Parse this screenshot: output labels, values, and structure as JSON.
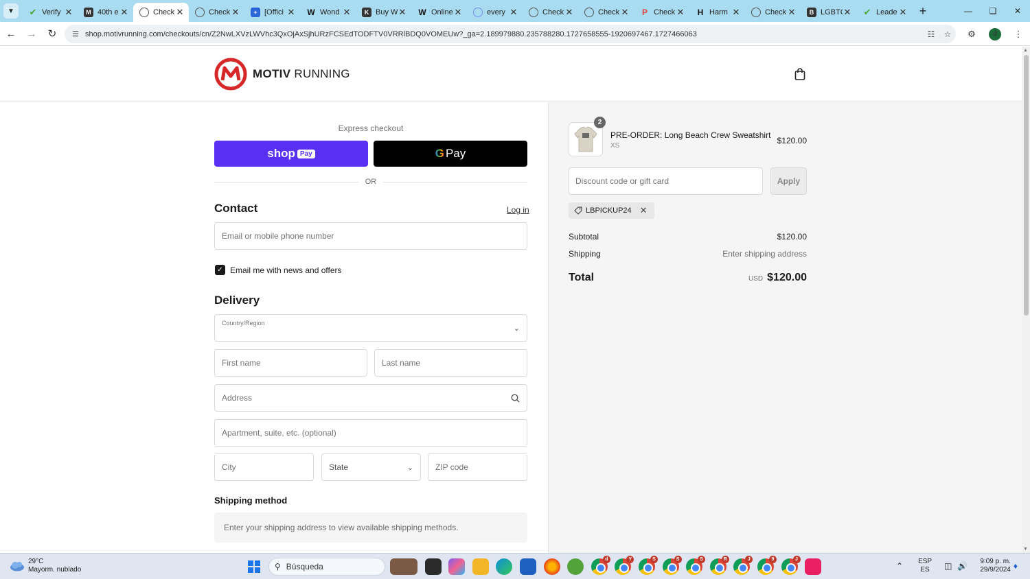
{
  "browser": {
    "tabs": [
      {
        "label": "Verify",
        "icon": "verify-check-favicon",
        "active": false
      },
      {
        "label": "40th e",
        "icon": "m-favicon",
        "active": false
      },
      {
        "label": "Check",
        "icon": "globe-favicon",
        "active": true
      },
      {
        "label": "Check",
        "icon": "globe-favicon",
        "active": false
      },
      {
        "label": "[Offici",
        "icon": "plus-favicon",
        "active": false
      },
      {
        "label": "Wond",
        "icon": "w-favicon",
        "active": false
      },
      {
        "label": "Buy W",
        "icon": "k-favicon",
        "active": false
      },
      {
        "label": "Online",
        "icon": "w-favicon",
        "active": false
      },
      {
        "label": "every",
        "icon": "ring-favicon",
        "active": false
      },
      {
        "label": "Check",
        "icon": "globe-favicon",
        "active": false
      },
      {
        "label": "Check",
        "icon": "globe-favicon",
        "active": false
      },
      {
        "label": "Check",
        "icon": "p-favicon",
        "active": false
      },
      {
        "label": "Harm",
        "icon": "h-favicon",
        "active": false
      },
      {
        "label": "Check",
        "icon": "globe-favicon",
        "active": false
      },
      {
        "label": "LGBTC",
        "icon": "b-favicon",
        "active": false
      },
      {
        "label": "Leade",
        "icon": "verify-check-favicon",
        "active": false
      }
    ],
    "url": "shop.motivrunning.com/checkouts/cn/Z2NwLXVzLWVhc3QxOjAxSjhURzFCSEdTODFTV0VRRlBDQ0VOMEUw?_ga=2.189979880.235788280.1727658555-1920697467.1727466063",
    "profile_initial": "d"
  },
  "store": {
    "logo_bold": "MOTIV",
    "logo_light": "RUNNING"
  },
  "checkout": {
    "express_label": "Express checkout",
    "shop_pay_label": "shop",
    "shop_pay_badge": "Pay",
    "gpay_g": "G",
    "gpay_label": "Pay",
    "or_label": "OR",
    "contact_heading": "Contact",
    "login_label": "Log in",
    "email_placeholder": "Email or mobile phone number",
    "newsletter_label": "Email me with news and offers",
    "newsletter_checked": true,
    "delivery_heading": "Delivery",
    "country_label": "Country/Region",
    "country_value": "",
    "first_name_placeholder": "First name",
    "last_name_placeholder": "Last name",
    "address_placeholder": "Address",
    "apartment_placeholder": "Apartment, suite, etc. (optional)",
    "city_placeholder": "City",
    "state_placeholder": "State",
    "zip_placeholder": "ZIP code",
    "shipping_method_heading": "Shipping method",
    "shipping_method_info": "Enter your shipping address to view available shipping methods."
  },
  "summary": {
    "item_quantity": "2",
    "item_name": "PRE-ORDER: Long Beach Crew Sweatshirt",
    "item_variant": "XS",
    "item_price": "$120.00",
    "discount_placeholder": "Discount code or gift card",
    "apply_label": "Apply",
    "applied_code": "LBPICKUP24",
    "subtotal_label": "Subtotal",
    "subtotal_value": "$120.00",
    "shipping_label": "Shipping",
    "shipping_value": "Enter shipping address",
    "total_label": "Total",
    "total_currency": "USD",
    "total_value": "$120.00"
  },
  "taskbar": {
    "temperature": "29°C",
    "weather_desc": "Mayorm. nublado",
    "search_label": "Búsqueda",
    "lang_top": "ESP",
    "lang_bottom": "ES",
    "time": "9:09 p. m.",
    "date": "29/9/2024",
    "chrome_badges": [
      "d",
      "Y",
      "S",
      "S",
      "S",
      "R",
      "J",
      "9",
      "J"
    ]
  },
  "colors": {
    "shop_pay": "#5a31f4",
    "gpay": "#000000",
    "brand_red": "#d62828",
    "tabbar": "#a9dcf0"
  }
}
